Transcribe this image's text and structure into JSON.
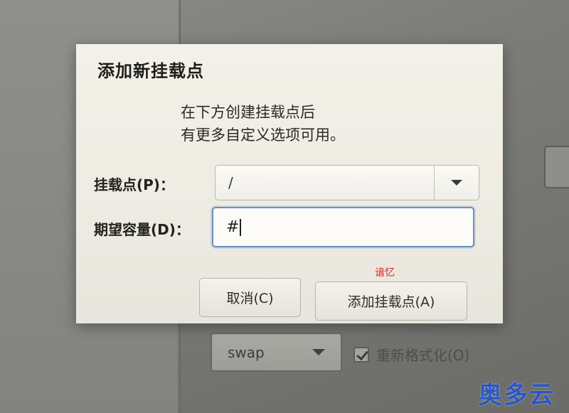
{
  "dialog": {
    "title": "添加新挂载点",
    "description_line1": "在下方创建挂载点后",
    "description_line2": "有更多自定义选项可用。",
    "mount_point": {
      "label": "挂载点(P)：",
      "value": "/"
    },
    "desired_capacity": {
      "label": "期望容量(D)：",
      "value": "#"
    },
    "cancel_label": "取消(C)",
    "add_label": "添加挂载点(A)"
  },
  "annotation": {
    "text": "谙忆",
    "color": "#d7261b"
  },
  "background": {
    "filesystem_value": "swap",
    "reformat_label": "重新格式化(O)",
    "reformat_checked": true
  },
  "watermark": {
    "text": "奥多云",
    "color": "#2a56c6"
  }
}
